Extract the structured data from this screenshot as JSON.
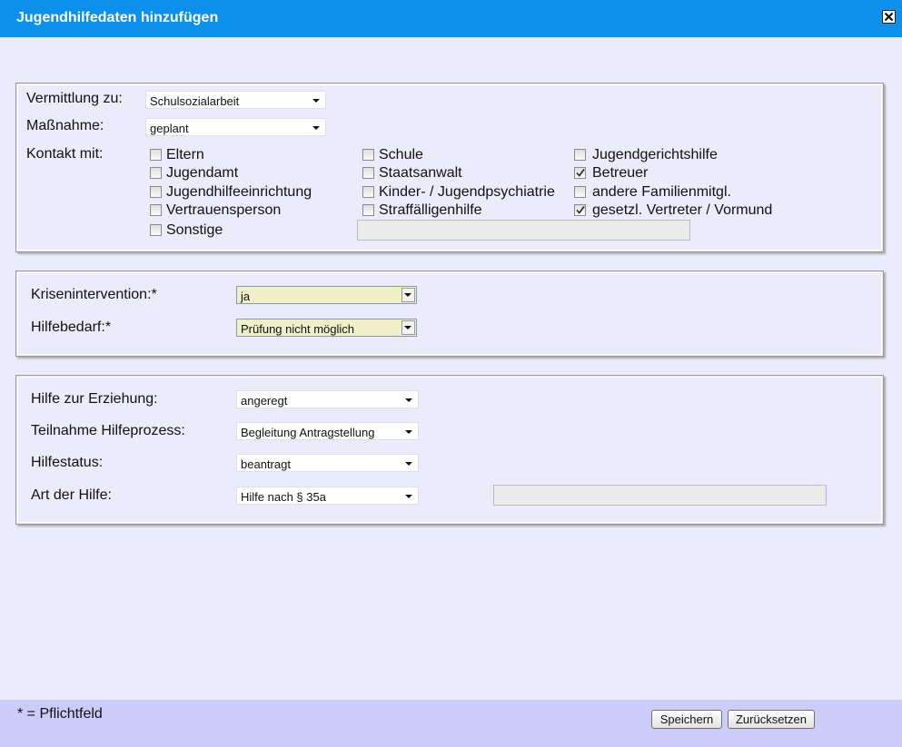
{
  "window": {
    "title": "Jugendhilfedaten hinzufügen"
  },
  "section1": {
    "vermittlung": {
      "label": "Vermittlung zu:",
      "value": "Schulsozialarbeit"
    },
    "massnahme": {
      "label": "Maßnahme:",
      "value": "geplant"
    },
    "kontakt_label": "Kontakt mit:",
    "checkboxes": [
      {
        "label": "Eltern",
        "checked": false
      },
      {
        "label": "Jugendamt",
        "checked": false
      },
      {
        "label": "Jugendhilfeeinrichtung",
        "checked": false
      },
      {
        "label": "Vertrauensperson",
        "checked": false
      },
      {
        "label": "Sonstige",
        "checked": false
      },
      {
        "label": "Schule",
        "checked": false
      },
      {
        "label": "Staatsanwalt",
        "checked": false
      },
      {
        "label": "Kinder- / Jugendpsychiatrie",
        "checked": false
      },
      {
        "label": "Straffälligenhilfe",
        "checked": false
      },
      {
        "label": "Jugendgerichtshilfe",
        "checked": false
      },
      {
        "label": "Betreuer",
        "checked": true
      },
      {
        "label": "andere Familienmitgl.",
        "checked": false
      },
      {
        "label": "gesetzl. Vertreter / Vormund",
        "checked": true
      }
    ],
    "sonstige_text": ""
  },
  "section2": {
    "krisenintervention": {
      "label": "Krisenintervention:*",
      "value": "ja"
    },
    "hilfebedarf": {
      "label": "Hilfebedarf:*",
      "value": "Prüfung nicht möglich"
    }
  },
  "section3": {
    "hilfe_erziehung": {
      "label": "Hilfe zur Erziehung:",
      "value": "angeregt"
    },
    "teilnahme": {
      "label": "Teilnahme Hilfeprozess:",
      "value": "Begleitung Antragstellung"
    },
    "hilfestatus": {
      "label": "Hilfestatus:",
      "value": "beantragt"
    },
    "art_der_hilfe": {
      "label": "Art der Hilfe:",
      "value": "Hilfe nach § 35a"
    },
    "art_text": ""
  },
  "footer": {
    "note": "* = Pflichtfeld",
    "save_label": "Speichern",
    "reset_label": "Zurücksetzen"
  }
}
